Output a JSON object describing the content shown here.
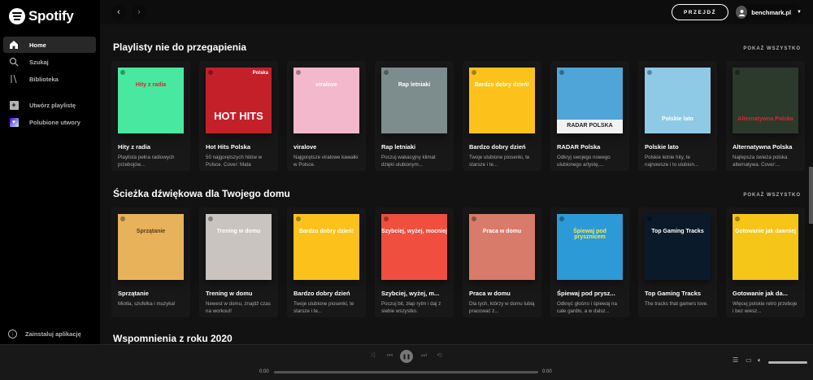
{
  "app": {
    "name": "Spotify"
  },
  "sidebar": {
    "nav": [
      {
        "label": "Home",
        "icon": "home-icon",
        "active": true
      },
      {
        "label": "Szukaj",
        "icon": "search-icon"
      },
      {
        "label": "Biblioteka",
        "icon": "library-icon"
      }
    ],
    "actions": [
      {
        "label": "Utwórz playlistę",
        "icon": "plus-icon"
      },
      {
        "label": "Polubione utwory",
        "icon": "heart-icon"
      }
    ],
    "install_label": "Zainstaluj aplikację"
  },
  "topbar": {
    "upgrade_label": "PRZEJDŹ",
    "username": "benchmark.pl"
  },
  "sections": [
    {
      "title": "Playlisty nie do przegapienia",
      "see_all": "POKAŻ WSZYSTKO",
      "cards": [
        {
          "title": "Hity z radia",
          "desc": "Playlista pełna radiowych przebojów...",
          "cover_text": "Hity z radia",
          "bg": "#49e8a0",
          "fg": "#e22134"
        },
        {
          "title": "Hot Hits Polska",
          "desc": "50 najgorętszych hitów w Polsce. Cover: Mata",
          "cover_text": "HOT HITS",
          "badge": "Polska",
          "bg": "#c4202a",
          "fg": "#ffffff"
        },
        {
          "title": "viralove",
          "desc": "Najgorętsze viralowe kawałki w Polsce.",
          "cover_text": "viralove",
          "bg": "#f4b8cc",
          "fg": "#ffffff"
        },
        {
          "title": "Rap letniaki",
          "desc": "Poczuj wakacyjny klimat dzięki ulubionym...",
          "cover_text": "Rap letniaki",
          "bg": "#7d8c8c",
          "fg": "#ffffff"
        },
        {
          "title": "Bardzo dobry dzień",
          "desc": "Twoje ulubione piosenki, te starsze i te...",
          "cover_text": "Bardzo dobry dzień!",
          "bg": "#fcc21b",
          "fg": "#ffffff"
        },
        {
          "title": "RADAR Polska",
          "desc": "Odkryj swojego nowego ulubionego artystę,...",
          "cover_text": "RADAR POLSKA",
          "bg": "#4fa5d8",
          "fg": "#ffffff"
        },
        {
          "title": "Polskie lato",
          "desc": "Polskie letnie hity, te najnowsze i to ulubion...",
          "cover_text": "Polskie lato",
          "bg": "#8ecae6",
          "fg": "#ffffff"
        },
        {
          "title": "Alternatywna Polska",
          "desc": "Najlepsza świeża polska alternatywa. Cover:...",
          "cover_text": "Alternatywna Polska",
          "bg": "#2b3a2b",
          "fg": "#e22134"
        }
      ]
    },
    {
      "title": "Ścieżka dźwiękowa dla Twojego domu",
      "see_all": "POKAŻ WSZYSTKO",
      "cards": [
        {
          "title": "Sprzątanie",
          "desc": "Miotła, szufelka i muzyka!",
          "cover_text": "Sprzątanie",
          "bg": "#e8b25a",
          "fg": "#5a3b1a"
        },
        {
          "title": "Trening w domu",
          "desc": "Newest w domu, znajdź czas na workout!",
          "cover_text": "Trening w domu",
          "bg": "#c9c4c0",
          "fg": "#ffffff"
        },
        {
          "title": "Bardzo dobry dzień",
          "desc": "Twoje ulubione piosenki, te starsze i te...",
          "cover_text": "Bardzo dobry dzień!",
          "bg": "#fcc21b",
          "fg": "#ffffff"
        },
        {
          "title": "Szybciej, wyżej, m...",
          "desc": "Poczuj bit, złap rytm i daj z siebie wszystko.",
          "cover_text": "Szybciej, wyżej, mocniej",
          "bg": "#f04e3e",
          "fg": "#ffffff"
        },
        {
          "title": "Praca w domu",
          "desc": "Dla tych, którzy w domu lubią pracować z...",
          "cover_text": "Praca w domu",
          "bg": "#d97b6a",
          "fg": "#ffffff"
        },
        {
          "title": "Śpiewaj pod prysz...",
          "desc": "Odkręć głośno i śpiewaj na całe gardło, a w dalsz...",
          "cover_text": "Śpiewaj pod prysznicem",
          "bg": "#2d9ad8",
          "fg": "#f5e84b"
        },
        {
          "title": "Top Gaming Tracks",
          "desc": "The tracks that gamers love.",
          "cover_text": "Top Gaming Tracks",
          "bg": "#0b1a2a",
          "fg": "#ffffff"
        },
        {
          "title": "Gotowanie jak da...",
          "desc": "Więcej polskie retro przeboje i bez wiesz...",
          "cover_text": "Gotowanie jak dawniej",
          "bg": "#f5c518",
          "fg": "#ffffff"
        }
      ]
    },
    {
      "title": "Wspomnienia z roku 2020"
    }
  ],
  "player": {
    "time_current": "0:00",
    "time_total": "0:00",
    "progress": 0,
    "volume": 1.0
  }
}
